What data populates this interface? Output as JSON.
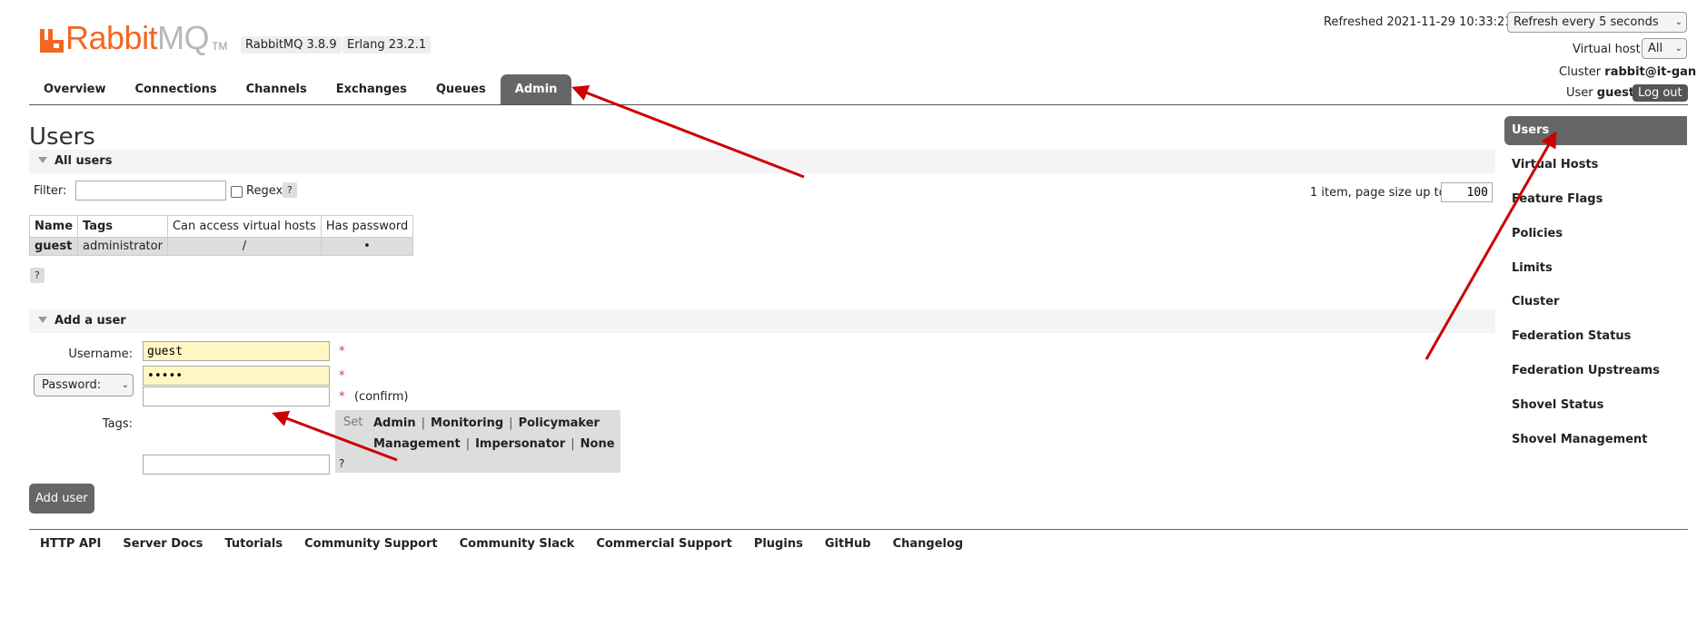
{
  "brand": {
    "name_part1": "Rabbit",
    "name_part2": "MQ",
    "tm": "TM",
    "version_badge": "RabbitMQ 3.8.9",
    "erlang_badge": "Erlang 23.2.1"
  },
  "header": {
    "refreshed_label": "Refreshed 2021-11-29 10:33:21",
    "refresh_select": "Refresh every 5 seconds",
    "vhost_label": "Virtual host",
    "vhost_select": "All",
    "cluster_label": "Cluster",
    "cluster_value": "rabbit@it-gan",
    "user_label": "User",
    "user_value": "guest",
    "logout": "Log out"
  },
  "tabs": [
    {
      "label": "Overview"
    },
    {
      "label": "Connections"
    },
    {
      "label": "Channels"
    },
    {
      "label": "Exchanges"
    },
    {
      "label": "Queues"
    },
    {
      "label": "Admin",
      "active": true
    }
  ],
  "page_title": "Users",
  "all_users": {
    "section_title": "All users",
    "filter_label": "Filter:",
    "filter_value": "",
    "regex_label": "Regex",
    "help": "?",
    "pagination_label": "1 item, page size up to",
    "page_size": "100",
    "columns": [
      "Name",
      "Tags",
      "Can access virtual hosts",
      "Has password"
    ],
    "rows": [
      {
        "name": "guest",
        "tags": "administrator",
        "vhosts": "/",
        "has_password": "•"
      }
    ],
    "table_help": "?"
  },
  "add_user": {
    "section_title": "Add a user",
    "username_label": "Username:",
    "username_value": "guest",
    "password_select": "Password:",
    "password_value": "•••••",
    "confirm_value": "",
    "required_mark": "*",
    "confirm_label": "(confirm)",
    "tags_label": "Tags:",
    "tags_value": "",
    "tags_set_label": "Set",
    "tag_options": [
      "Admin",
      "Monitoring",
      "Policymaker",
      "Management",
      "Impersonator",
      "None"
    ],
    "tags_separator": "|",
    "tags_help": "?",
    "submit": "Add user"
  },
  "sidebar": {
    "items": [
      {
        "label": "Users",
        "active": true
      },
      {
        "label": "Virtual Hosts"
      },
      {
        "label": "Feature Flags"
      },
      {
        "label": "Policies"
      },
      {
        "label": "Limits"
      },
      {
        "label": "Cluster"
      },
      {
        "label": "Federation Status"
      },
      {
        "label": "Federation Upstreams"
      },
      {
        "label": "Shovel Status"
      },
      {
        "label": "Shovel Management"
      }
    ]
  },
  "footer": {
    "links": [
      "HTTP API",
      "Server Docs",
      "Tutorials",
      "Community Support",
      "Community Slack",
      "Commercial Support",
      "Plugins",
      "GitHub",
      "Changelog"
    ]
  },
  "colors": {
    "brand_orange": "#f26722",
    "active_tab": "#666666",
    "annotation_arrow": "#cc0000",
    "filled_input": "#fff6c4"
  },
  "icons": [
    "rabbitmq-logo-icon",
    "chevron-down-icon",
    "expand-triangle-icon",
    "checkbox-icon",
    "annotation-arrow"
  ]
}
